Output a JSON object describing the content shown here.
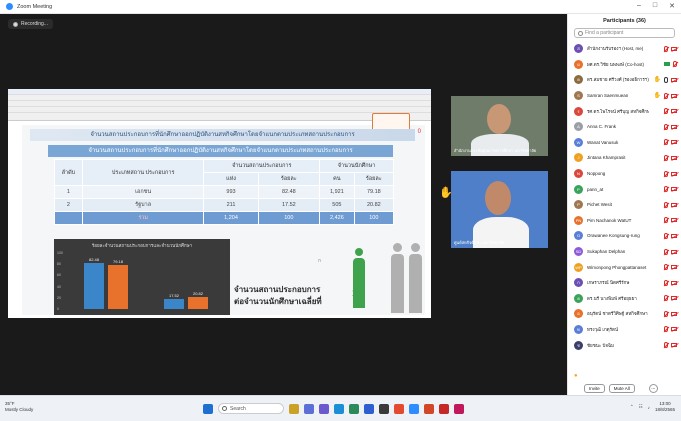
{
  "window": {
    "title": "Zoom Meeting"
  },
  "recording": {
    "label": "Recording..."
  },
  "slide": {
    "header": "จำนวนสถานประกอบการที่นักศึกษาออกปฏิบัติงานสหกิจศึกษาโดยจำแนกตามประเภทสถานประกอบการ",
    "table_title": "จำนวนสถานประกอบการที่นักศึกษาออกปฏิบัติงานสหกิจศึกษาโดยจำแนกตามประเภทสถานประกอบการ",
    "side_mark": "0",
    "columns": {
      "seq": "ลำดับ",
      "type": "ประเภทสถาน ประกอบการ",
      "company_group": "จำนวนสถานประกอบการ",
      "student_group": "จำนวนนักศึกษา",
      "count": "แห่ง",
      "count_pct": "ร้อยละ",
      "persons": "คน",
      "persons_pct": "ร้อยละ"
    },
    "rows": [
      {
        "seq": "1",
        "type": "เอกชน",
        "count": "993",
        "count_pct": "82.48",
        "persons": "1,921",
        "persons_pct": "79.18"
      },
      {
        "seq": "2",
        "type": "รัฐบาล",
        "count": "211",
        "count_pct": "17.52",
        "persons": "505",
        "persons_pct": "20.82"
      }
    ],
    "total": {
      "label": "รวม",
      "count": "1,204",
      "count_pct": "100",
      "persons": "2,426",
      "persons_pct": "100"
    },
    "ratio_text_line1": "จำนวนสถานประกอบการ",
    "ratio_text_line2": "ต่อจำนวนนักศึกษาเฉลี่ยที่",
    "ratio_value": "1:2",
    "page_dots": "ก"
  },
  "chart_data": {
    "type": "bar",
    "title": "ร้อยละจำนวนสถานประกอบการและจำนวนนักศึกษา",
    "categories": [
      "เอกชน",
      "รัฐบาล"
    ],
    "series": [
      {
        "values": [
          82.48,
          17.52
        ],
        "color": "#3a86c8"
      },
      {
        "values": [
          79.18,
          20.82
        ],
        "color": "#e8712c"
      }
    ],
    "data_labels": [
      "82.48",
      "79.18",
      "17.52",
      "20.82"
    ],
    "ylim": [
      0,
      100
    ],
    "yticks": [
      "100",
      "80",
      "60",
      "40",
      "20",
      "0"
    ]
  },
  "videos": [
    {
      "name": "สำนักงานประกันคุณภาพการศึกษา มหาวิทยาลัย"
    },
    {
      "name": "ศูนย์สหกิจศึกษา มหาวิทยาลัย"
    }
  ],
  "participants_panel": {
    "title": "Participants (36)",
    "search_placeholder": "Find a participant",
    "participants": [
      {
        "name": "สำนักงานรับรองฯ (Host, me)",
        "initial": "ส",
        "color": "#6c4fb3",
        "icons": [
          "mic-off",
          "cam-off"
        ]
      },
      {
        "name": "ผศ.ดร.วิชัย นพพงษ์ (Co-host)",
        "initial": "ผ",
        "color": "#e8712c",
        "icons": [
          "cam-on",
          "mic-off"
        ]
      },
      {
        "name": "ดร.สมชาย ศรีวงศ์ (รองอธิการฯ)",
        "initial": "ด",
        "color": "#8c6b3f",
        "icons": [
          "hand",
          "mic-on",
          "cam-off"
        ]
      },
      {
        "name": "Samran Saenmuean",
        "initial": "S",
        "color": "#a07850",
        "icons": [
          "hand",
          "mic-off",
          "cam-off"
        ]
      },
      {
        "name": "รศ.ดร.ไพโรจน์ ศรีบุญ สหกิจศึกษา",
        "initial": "ร",
        "color": "#d9483b",
        "icons": [
          "mic-off",
          "cam-off"
        ]
      },
      {
        "name": "Anna C. Frank",
        "initial": "A",
        "color": "#9aa0a6",
        "icons": [
          "mic-off",
          "cam-off"
        ]
      },
      {
        "name": "Wanat Vanusuk",
        "initial": "W",
        "color": "#5b7fd6",
        "icons": [
          "mic-off",
          "cam-off"
        ]
      },
      {
        "name": "Jintana Khamprasit",
        "initial": "J",
        "color": "#f0a020",
        "icons": [
          "mic-off",
          "cam-off"
        ]
      },
      {
        "name": "Noppong",
        "initial": "N",
        "color": "#d9483b",
        "icons": [
          "mic-off",
          "cam-off"
        ]
      },
      {
        "name": "pann_at",
        "initial": "P",
        "color": "#3aa35a",
        "icons": [
          "mic-off",
          "cam-off"
        ]
      },
      {
        "name": "Pichet Wesit",
        "initial": "P",
        "color": "#a07850",
        "icons": [
          "mic-off",
          "cam-off"
        ]
      },
      {
        "name": "Pim Nachanok WatUT",
        "initial": "PN",
        "color": "#e8712c",
        "icons": [
          "mic-off",
          "cam-off"
        ]
      },
      {
        "name": "Orawanee Kongsung-rung",
        "initial": "O",
        "color": "#5b7fd6",
        "icons": [
          "mic-off",
          "cam-off"
        ]
      },
      {
        "name": "Sukaphan Delphan",
        "initial": "SD",
        "color": "#8e5bd6",
        "icons": [
          "mic-off",
          "cam-off"
        ]
      },
      {
        "name": "Wimonpong Phongpattanaset",
        "initial": "WP",
        "color": "#f0a020",
        "icons": [
          "mic-off",
          "cam-off"
        ]
      },
      {
        "name": "เกษราภรณ์ นิตศรีรักษ",
        "initial": "ก",
        "color": "#6c4fb3",
        "icons": [
          "mic-off",
          "cam-off"
        ]
      },
      {
        "name": "ดร.นรี นางพิมพ์ ศรีอยุธยา",
        "initial": "ด",
        "color": "#3aa35a",
        "icons": [
          "mic-off",
          "cam-off"
        ]
      },
      {
        "name": "อนุรัตน์ ชาตรีวิศิษฐ์ สหกิจศึกษา",
        "initial": "อ",
        "color": "#e8712c",
        "icons": [
          "mic-off",
          "cam-off"
        ]
      },
      {
        "name": "ทรงวุฒิ เกตุรัตน์",
        "initial": "ท",
        "color": "#5b7fd6",
        "icons": [
          "mic-off",
          "cam-off"
        ]
      },
      {
        "name": "ชัยชนะ ปัจฉิม",
        "initial": "ช",
        "color": "#3a3f6b",
        "icons": [
          "mic-off",
          "cam-off"
        ]
      }
    ],
    "invite_label": "Invite",
    "mute_all_label": "Mute All",
    "more_label": "..."
  },
  "taskbar": {
    "weather_temp": "35°F",
    "weather_desc": "Mostly Cloudy",
    "search_label": "Search",
    "time": "13:00",
    "date": "18/8/2565"
  }
}
